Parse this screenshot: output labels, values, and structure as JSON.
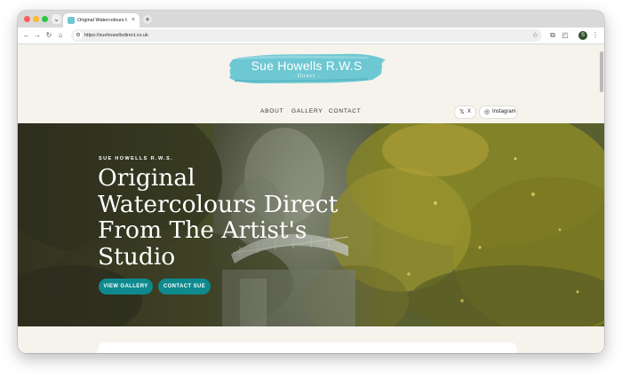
{
  "browser": {
    "tab_title": "Original Watercolours by Sue",
    "tab_close": "×",
    "new_tab": "+",
    "url": "https://suehowellsdirect.co.uk",
    "avatar_letter": "S"
  },
  "site": {
    "logo_title": "Sue Howells R.W.S",
    "logo_subtitle": "- Direct -",
    "nav": [
      {
        "label": "ABOUT"
      },
      {
        "label": "GALLERY"
      },
      {
        "label": "CONTACT"
      }
    ],
    "social": [
      {
        "label": "X",
        "icon": "x-logo-icon"
      },
      {
        "label": "Instagram",
        "icon": "instagram-icon"
      }
    ]
  },
  "hero": {
    "eyebrow": "SUE HOWELLS R.W.S.",
    "headline_lines": [
      "Original",
      "Watercolours Direct",
      "From The Artist's",
      "Studio"
    ],
    "primary_button": "VIEW GALLERY",
    "secondary_button": "CONTACT SUE"
  },
  "colors": {
    "accent": "#0e8a8e",
    "logo_brush": "#6ec8d3",
    "page_bg": "#f5f3ec"
  }
}
